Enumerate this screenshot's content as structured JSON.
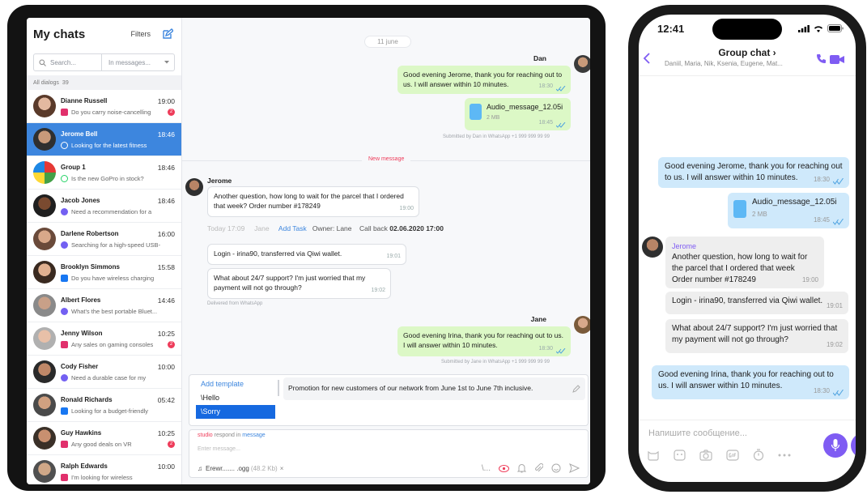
{
  "sidebar": {
    "title": "My chats",
    "filters_label": "Filters",
    "search_placeholder": "Search...",
    "search_scope": "In messages...",
    "all_dialogs_label": "All dialogs",
    "all_dialogs_count": "39",
    "chats": [
      {
        "name": "Dianne Russell",
        "time": "19:00",
        "message": "Do you carry noise-cancelling",
        "channel": "instagram",
        "badge": "2"
      },
      {
        "name": "Jerome Bell",
        "time": "18:46",
        "message": "Looking for the latest fitness",
        "channel": "whatsapp",
        "badge": ""
      },
      {
        "name": "Group 1",
        "time": "18:46",
        "message": "Is the new GoPro in stock?",
        "channel": "whatsapp",
        "badge": ""
      },
      {
        "name": "Jacob Jones",
        "time": "18:46",
        "message": "Need a recommendation for a",
        "channel": "viber",
        "badge": ""
      },
      {
        "name": "Darlene Robertson",
        "time": "16:00",
        "message": "Searching for a high-speed USB-",
        "channel": "viber",
        "badge": ""
      },
      {
        "name": "Brooklyn Simmons",
        "time": "15:58",
        "message": "Do you have wireless charging",
        "channel": "facebook",
        "badge": ""
      },
      {
        "name": "Albert Flores",
        "time": "14:46",
        "message": "What's the best portable Bluet...",
        "channel": "viber",
        "badge": ""
      },
      {
        "name": "Jenny Wilson",
        "time": "10:25",
        "message": "Any sales on gaming consoles",
        "channel": "instagram",
        "badge": "2"
      },
      {
        "name": "Cody Fisher",
        "time": "10:00",
        "message": "Need a durable case for my",
        "channel": "viber",
        "badge": ""
      },
      {
        "name": "Ronald Richards",
        "time": "05:42",
        "message": "Looking for a budget-friendly",
        "channel": "facebook",
        "badge": ""
      },
      {
        "name": "Guy Hawkins",
        "time": "10:25",
        "message": "Any good deals on VR",
        "channel": "instagram",
        "badge": "2"
      },
      {
        "name": "Ralph Edwards",
        "time": "10:00",
        "message": "I'm looking for wireless",
        "channel": "instagram",
        "badge": ""
      }
    ]
  },
  "chat": {
    "date": "11 june",
    "out1": {
      "sender": "Dan",
      "text": "Good evening Jerome, thank you for reaching out to us. I will answer within 10 minutes.",
      "time": "18:30"
    },
    "audio": {
      "name": "Audio_message_12.05i",
      "size": "2 MB",
      "time": "18:45"
    },
    "submitted1": "Submitted by Dan in WhatsApp +1 999 999 99 99",
    "new_message": "New message",
    "in_sender": "Jerome",
    "in1": {
      "text": "Another question, how long to wait for the parcel that I ordered that week? Order number #178249",
      "time": "19:00"
    },
    "task": {
      "time": "Today 17:09",
      "user": "Jane",
      "add": "Add Task",
      "owner": "Owner: Lane",
      "callback_label": "Call back",
      "callback_date": "02.06.2020 17:00"
    },
    "in2": {
      "text": "Login - irina90, transferred via Qiwi wallet.",
      "time": "19:01"
    },
    "in3": {
      "text": "What about 24/7 support? I'm just worried that my payment will not go through?",
      "time": "19:02"
    },
    "delivered": "Delivered from WhatsApp",
    "out2": {
      "sender": "Jane",
      "text": "Good evening Irina, thank you for reaching out to us. I will answer within 10 minutes.",
      "time": "18:30"
    },
    "submitted2": "Submitted by Jane in WhatsApp +1 999 999 99 99",
    "templates": {
      "add": "Add template",
      "items": [
        "\\Hello",
        "\\Sorry"
      ],
      "preview": "Promotion for new customers of our network from June 1st to June 7th inclusive."
    },
    "input": {
      "studio": "studio",
      "respond": "respond in",
      "message": "message",
      "placeholder": "Enter message...",
      "file_name": "Erewr....... .ogg",
      "file_size": "(48.2 Kb)",
      "file_remove": "×",
      "slash": "\\..."
    }
  },
  "phone": {
    "status_time": "12:41",
    "title": "Group chat",
    "title_chevron": "›",
    "members": "Daniil, Maria, Nik, Ksenia, Eugene, Mat...",
    "out1": {
      "text": "Good evening Jerome, thank you for reaching out to us. I will answer within 10 minutes.",
      "time": "18:30"
    },
    "audio": {
      "name": "Audio_message_12.05i",
      "size": "2 MB",
      "time": "18:45"
    },
    "in_sender": "Jerome",
    "in1": {
      "text": "Another question, how long to wait for the parcel that I ordered that week Order number #178249",
      "time": "19:00"
    },
    "in2": {
      "text": "Login - irina90, transferred via Qiwi wallet.",
      "time": "19:01"
    },
    "in3": {
      "text": "What about 24/7 support? I'm just worried that my payment will not go through?",
      "time": "19:02"
    },
    "out2": {
      "text": "Good evening Irina, thank you for reaching out to us. I will answer within 10 minutes.",
      "time": "18:30"
    },
    "input_placeholder": "Напишите сообщение..."
  },
  "colors": {
    "accent": "#3d86de",
    "outgoing": "#dcf8c6",
    "phone_outgoing": "#cfe9fb",
    "badge": "#ee3c5a",
    "viber": "#7f5cf3"
  }
}
